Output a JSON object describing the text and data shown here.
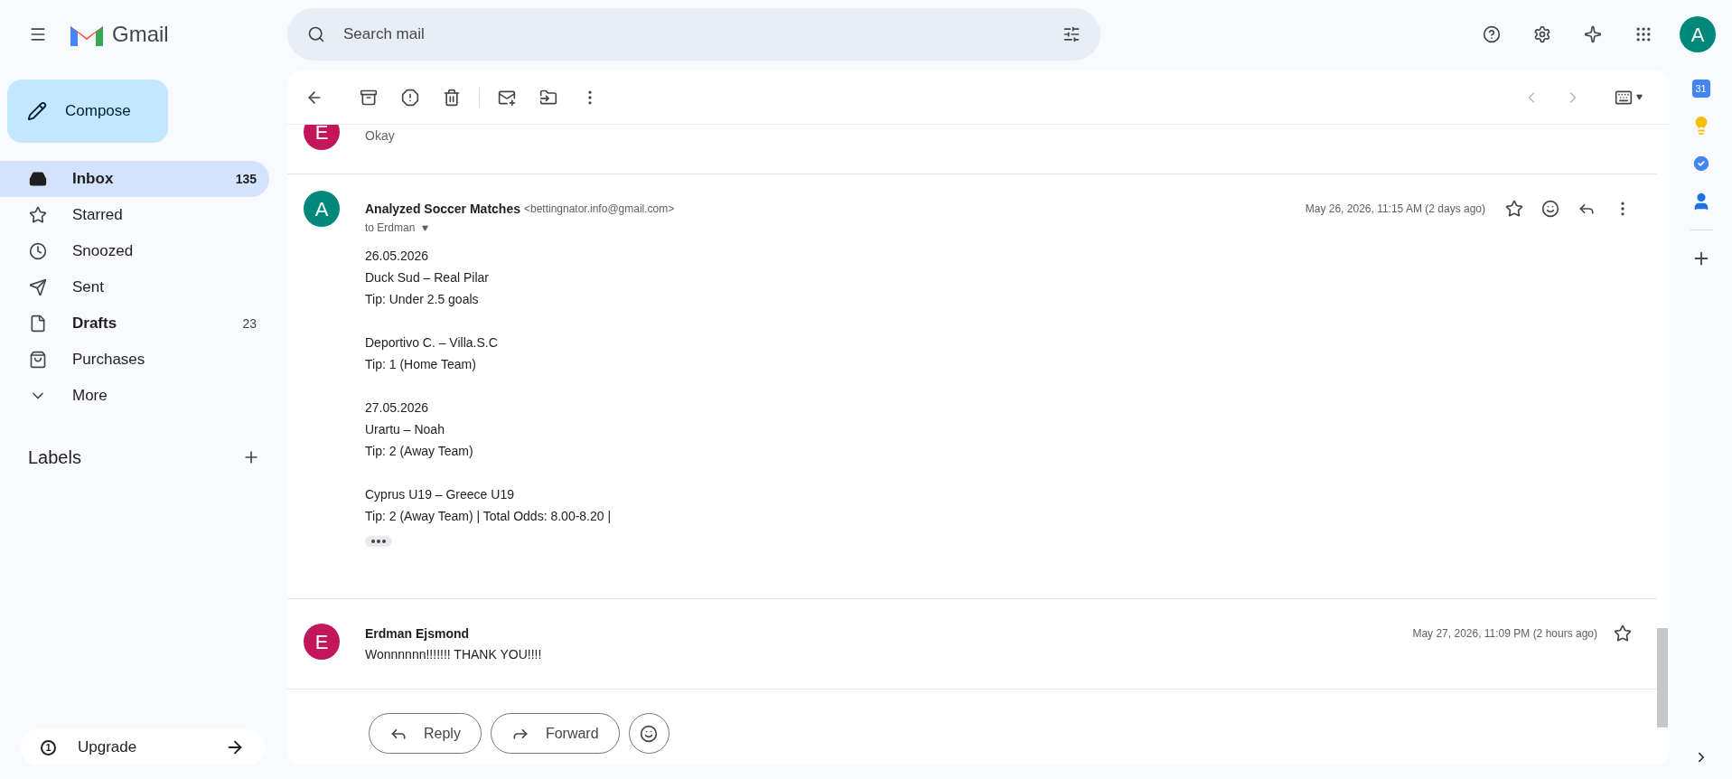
{
  "app": {
    "name": "Gmail"
  },
  "search": {
    "placeholder": "Search mail"
  },
  "account": {
    "initial": "A"
  },
  "compose": {
    "label": "Compose"
  },
  "sidebar": {
    "items": [
      {
        "kind": "inbox",
        "label": "Inbox",
        "count": "135",
        "bold": true,
        "selected": true
      },
      {
        "kind": "star",
        "label": "Starred",
        "bold": false,
        "selected": false
      },
      {
        "kind": "clock",
        "label": "Snoozed",
        "bold": false,
        "selected": false
      },
      {
        "kind": "send",
        "label": "Sent",
        "bold": false,
        "selected": false
      },
      {
        "kind": "file",
        "label": "Drafts",
        "count": "23",
        "bold": true,
        "selected": false
      },
      {
        "kind": "bag",
        "label": "Purchases",
        "bold": false,
        "selected": false
      },
      {
        "kind": "more",
        "label": "More",
        "bold": false,
        "selected": false
      }
    ],
    "labels_heading": "Labels",
    "upgrade": {
      "badge": "1",
      "label": "Upgrade"
    }
  },
  "messages": [
    {
      "kind": "cut",
      "initial": "E",
      "color": "#c2185b",
      "snippet": "Okay"
    },
    {
      "kind": "open",
      "initial": "A",
      "color": "#00897b",
      "sender": "Analyzed Soccer Matches",
      "email": "<bettingnator.info@gmail.com>",
      "to": "to Erdman",
      "date": "May 26, 2026, 11:15 AM (2 days ago)",
      "body": [
        [
          "26.05.2026",
          "Duck Sud – Real Pilar",
          "Tip: Under 2.5 goals"
        ],
        [
          "Deportivo C. – Villa.S.C",
          "Tip: 1 (Home Team)"
        ],
        [
          "27.05.2026",
          "Urartu – Noah",
          "Tip: 2 (Away Team)"
        ],
        [
          "Cyprus U19 – Greece U19",
          "Tip: 2 (Away Team) | Total Odds: 8.00-8.20 |"
        ]
      ]
    },
    {
      "kind": "collapsed",
      "initial": "E",
      "color": "#c2185b",
      "sender": "Erdman Ejsmond",
      "snippet": "Wonnnnnn!!!!!!! THANK YOU!!!!",
      "date": "May 27, 2026, 11:09 PM (2 hours ago)"
    }
  ],
  "actions": [
    "Reply",
    "Forward"
  ],
  "right_rail": {
    "calendar_day": "31"
  }
}
